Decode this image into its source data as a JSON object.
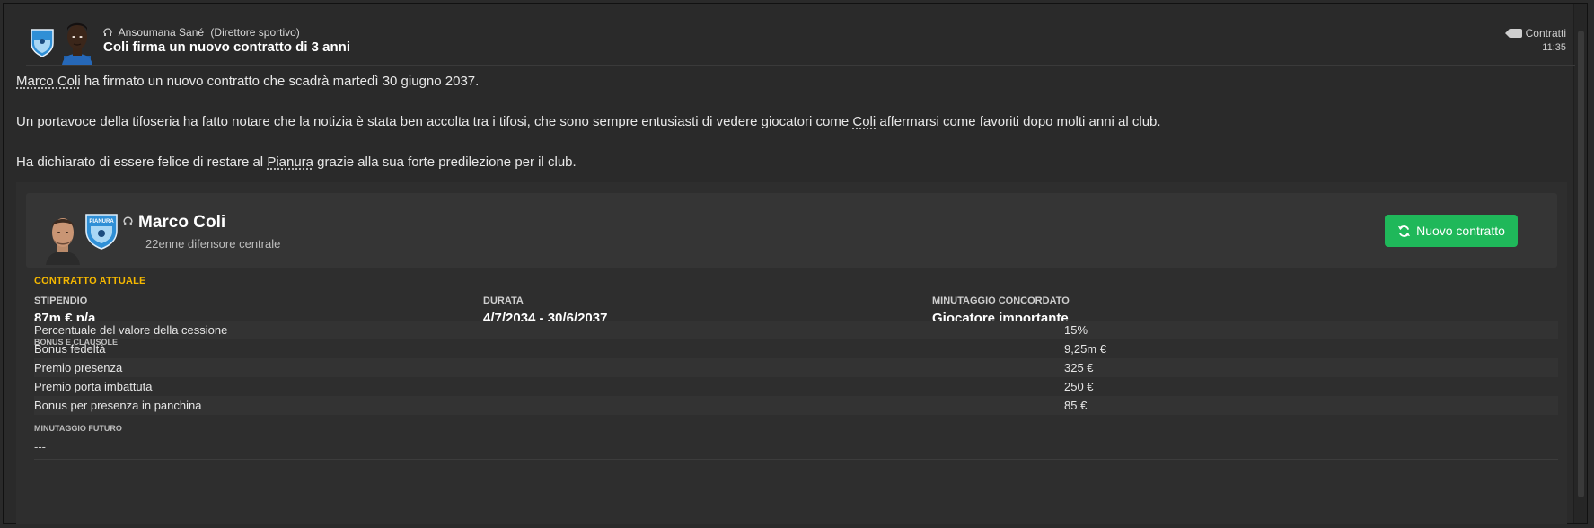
{
  "header": {
    "sender_name": "Ansoumana Sané",
    "sender_role": "(Direttore sportivo)",
    "headline": "Coli firma un nuovo contratto di 3 anni",
    "category": "Contratti",
    "time": "11:35"
  },
  "body": {
    "p1_name": "Marco Coli",
    "p1_rest": " ha firmato un nuovo contratto che scadrà martedì 30 giugno 2037.",
    "p2_pre": "Un portavoce della tifoseria ha fatto notare che la notizia è stata ben accolta tra i tifosi, che sono sempre entusiasti di vedere giocatori come ",
    "p2_name": "Coli",
    "p2_post": " affermarsi come favoriti dopo molti anni al club.",
    "p3_pre": "Ha dichiarato di essere felice di restare al ",
    "p3_club": "Pianura",
    "p3_post": " grazie alla sua forte predilezione per il club."
  },
  "card": {
    "player_name": "Marco Coli",
    "player_desc": "22enne difensore centrale",
    "new_contract_button": "Nuovo contratto",
    "section_title": "CONTRATTO ATTUALE",
    "wage_label": "STIPENDIO",
    "wage_value": "87m € p/a",
    "duration_label": "DURATA",
    "duration_value": "4/7/2034 - 30/6/2037",
    "playing_time_label": "MINUTAGGIO CONCORDATO",
    "playing_time_value": "Giocatore importante",
    "bonus_label": "BONUS E CLAUSOLE",
    "bonuses": [
      {
        "name": "Percentuale del valore della cessione",
        "value": "15%"
      },
      {
        "name": "Bonus fedeltà",
        "value": "9,25m €"
      },
      {
        "name": "Premio presenza",
        "value": "325 €"
      },
      {
        "name": "Premio porta imbattuta",
        "value": "250 €"
      },
      {
        "name": "Bonus per presenza in panchina",
        "value": "85 €"
      }
    ],
    "future_label": "MINUTAGGIO FUTURO",
    "future_value": "---",
    "badge_text": "PIANURA"
  },
  "colors": {
    "accent_yellow": "#f5b800",
    "button_green": "#1fb85a",
    "background": "#2a2a2a"
  },
  "icons": [
    "club-badge-icon",
    "person-icon",
    "tag-icon",
    "refresh-icon"
  ]
}
